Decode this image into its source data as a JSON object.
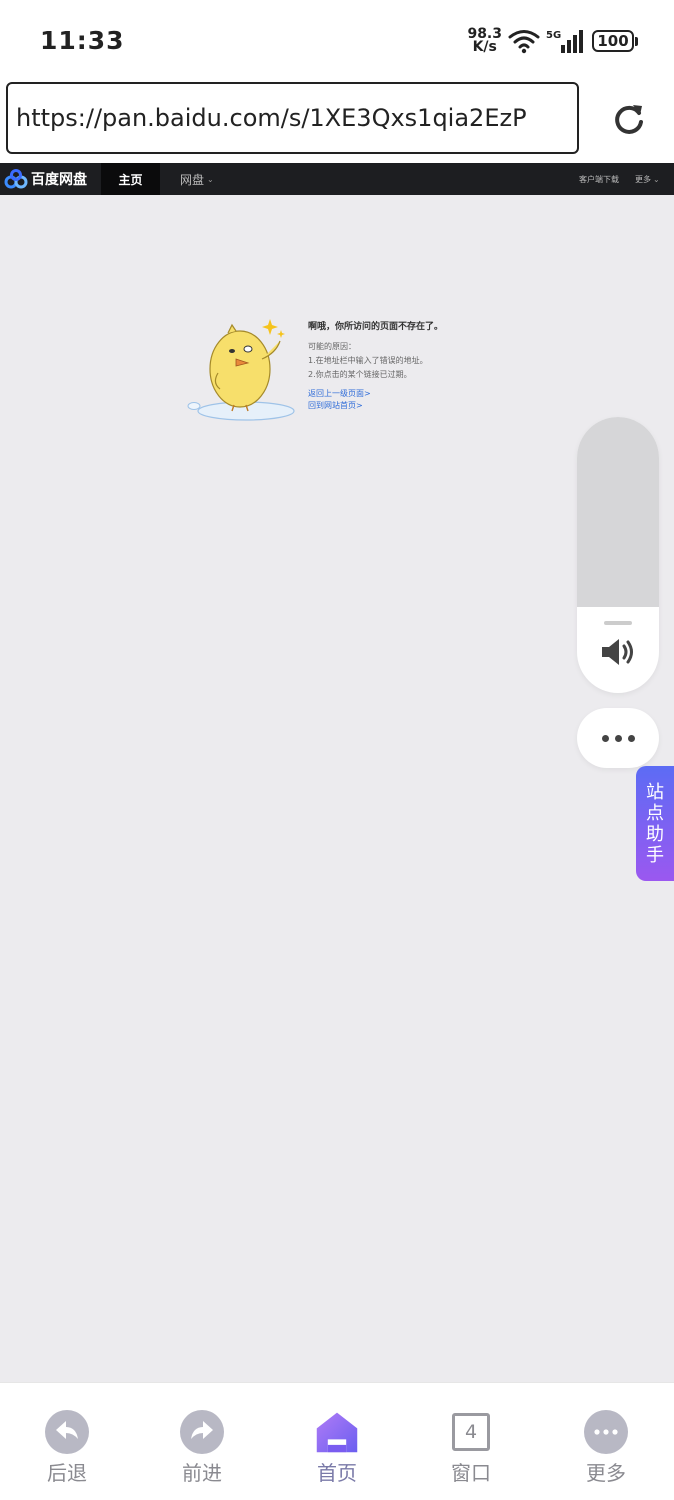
{
  "status_bar": {
    "time": "11:33",
    "net_speed_value": "98.3",
    "net_speed_unit": "K/s",
    "network": "5G",
    "battery": "100"
  },
  "browser": {
    "url": "https://pan.baidu.com/s/1XE3Qxs1qia2EzP"
  },
  "site": {
    "logo_text": "百度网盘",
    "nav": {
      "home": "主页",
      "disk": "网盘",
      "client": "客户端下载",
      "more": "更多"
    }
  },
  "error_page": {
    "title": "啊哦，你所访问的页面不存在了。",
    "reasons_label": "可能的原因：",
    "reason_1": "1.在地址栏中输入了错误的地址。",
    "reason_2": "2.你点击的某个链接已过期。",
    "link_back": "返回上一级页面>",
    "link_home": "回到网站首页>"
  },
  "floating": {
    "assistant_label": "站点助手"
  },
  "toolbar": {
    "back": "后退",
    "forward": "前进",
    "home": "首页",
    "window_count": "4",
    "window": "窗口",
    "more": "更多"
  },
  "colors": {
    "accent": "#7b5cf0",
    "nav_bg": "#1d1e21",
    "page_bg": "#ecebee",
    "link": "#2f6cd8"
  }
}
